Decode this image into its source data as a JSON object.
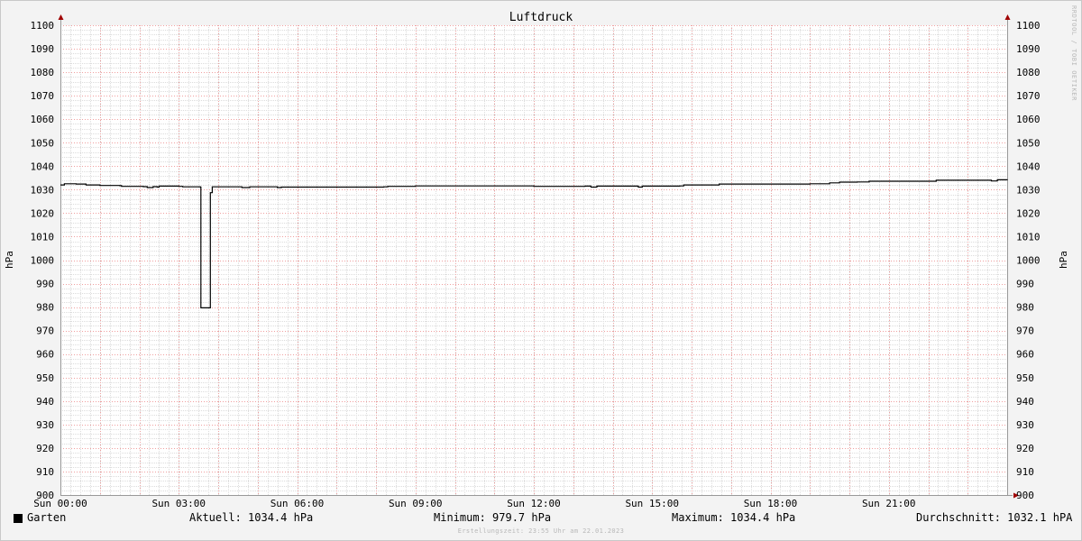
{
  "chart_data": {
    "type": "line",
    "title": "Luftdruck",
    "ylabel": "hPa",
    "ylabel_right": "hPa",
    "ylim": [
      900,
      1100
    ],
    "y_ticks": [
      900,
      910,
      920,
      930,
      940,
      950,
      960,
      970,
      980,
      990,
      1000,
      1010,
      1020,
      1030,
      1040,
      1050,
      1060,
      1070,
      1080,
      1090,
      1100
    ],
    "x_range_hours": [
      0,
      24
    ],
    "x_ticks": [
      {
        "hour": 0,
        "label": "Sun 00:00"
      },
      {
        "hour": 3,
        "label": "Sun 03:00"
      },
      {
        "hour": 6,
        "label": "Sun 06:00"
      },
      {
        "hour": 9,
        "label": "Sun 09:00"
      },
      {
        "hour": 12,
        "label": "Sun 12:00"
      },
      {
        "hour": 15,
        "label": "Sun 15:00"
      },
      {
        "hour": 18,
        "label": "Sun 18:00"
      },
      {
        "hour": 21,
        "label": "Sun 21:00"
      }
    ],
    "grid": true,
    "series": [
      {
        "name": "Garten",
        "color": "#000000",
        "points": [
          [
            0.0,
            1032.0
          ],
          [
            0.1,
            1032.5
          ],
          [
            0.4,
            1032.4
          ],
          [
            0.65,
            1032.0
          ],
          [
            1.0,
            1031.8
          ],
          [
            1.5,
            1031.7
          ],
          [
            1.55,
            1031.4
          ],
          [
            2.1,
            1031.3
          ],
          [
            2.2,
            1030.9
          ],
          [
            2.35,
            1031.3
          ],
          [
            2.45,
            1031.1
          ],
          [
            2.5,
            1031.5
          ],
          [
            3.0,
            1031.4
          ],
          [
            3.1,
            1031.2
          ],
          [
            3.55,
            1031.1
          ],
          [
            3.56,
            979.7
          ],
          [
            3.62,
            979.7
          ],
          [
            3.8,
            1028.7
          ],
          [
            3.85,
            1031.2
          ],
          [
            4.5,
            1031.2
          ],
          [
            4.6,
            1030.9
          ],
          [
            4.8,
            1031.2
          ],
          [
            5.4,
            1031.2
          ],
          [
            5.5,
            1030.9
          ],
          [
            5.6,
            1031.1
          ],
          [
            6.0,
            1031.1
          ],
          [
            8.2,
            1031.2
          ],
          [
            8.3,
            1031.4
          ],
          [
            8.9,
            1031.4
          ],
          [
            9.0,
            1031.6
          ],
          [
            11.9,
            1031.6
          ],
          [
            12.0,
            1031.4
          ],
          [
            13.3,
            1031.5
          ],
          [
            13.45,
            1031.1
          ],
          [
            13.6,
            1031.5
          ],
          [
            14.55,
            1031.5
          ],
          [
            14.65,
            1031.1
          ],
          [
            14.75,
            1031.5
          ],
          [
            15.7,
            1031.6
          ],
          [
            15.8,
            1032.0
          ],
          [
            16.6,
            1032.0
          ],
          [
            16.7,
            1032.4
          ],
          [
            19.0,
            1032.5
          ],
          [
            19.5,
            1032.9
          ],
          [
            19.75,
            1033.2
          ],
          [
            20.2,
            1033.3
          ],
          [
            20.5,
            1033.6
          ],
          [
            22.1,
            1033.6
          ],
          [
            22.2,
            1034.0
          ],
          [
            23.5,
            1034.0
          ],
          [
            23.6,
            1033.7
          ],
          [
            23.75,
            1034.2
          ],
          [
            24.0,
            1034.4
          ]
        ]
      }
    ],
    "legend": {
      "series_name": "Garten",
      "current": "Aktuell: 1034.4 hPa",
      "minimum": "Minimum: 979.7 hPa",
      "maximum": "Maximum: 1034.4 hPa",
      "average": "Durchschnitt: 1032.1 hPA"
    },
    "footer": "Erstellungszeit: 23:55 Uhr am 22.01.2023",
    "watermark": "RRDTOOL / TOBI OETIKER",
    "colors": {
      "background": "#f3f3f3",
      "plot_background": "#ffffff",
      "major_grid": "#f0a0a0",
      "minor_grid": "#dcdcdc",
      "axis": "#999999",
      "arrow": "#a00000",
      "line": "#000000"
    }
  }
}
